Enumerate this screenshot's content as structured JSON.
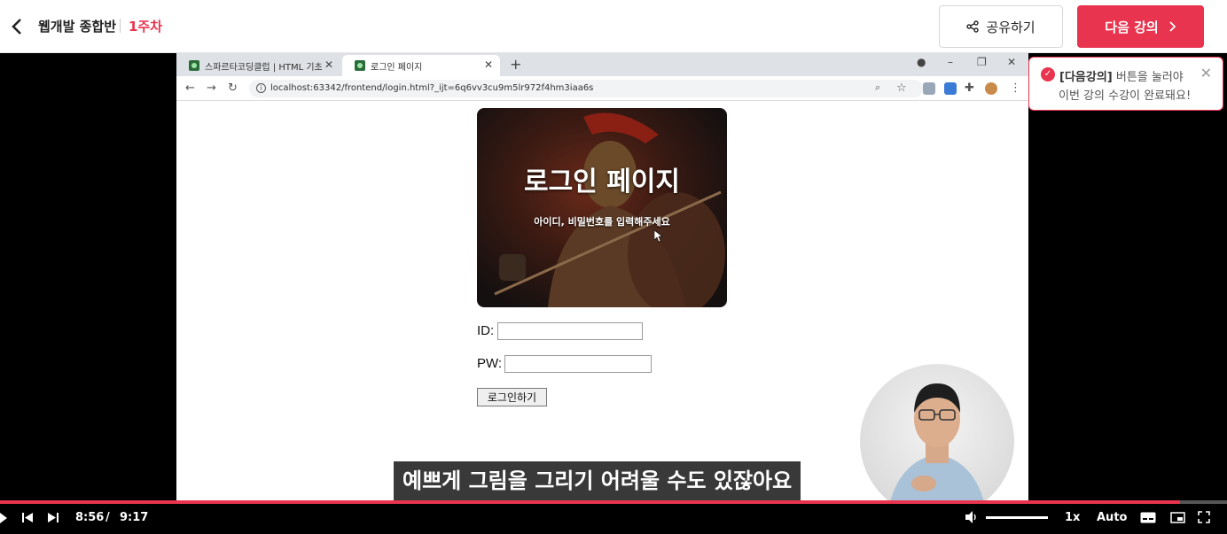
{
  "header": {
    "course_title": "웹개발 종합반",
    "week": "1주차",
    "share_label": "공유하기",
    "next_label": "다음 강의"
  },
  "tooltip": {
    "emphasis": "[다음강의]",
    "line1_rest": " 버튼을 눌러야",
    "line2": "이번 강의 수강이 완료돼요!"
  },
  "browser": {
    "tabs": [
      {
        "title": "스파르타코딩클럽 | HTML 기초",
        "active": false
      },
      {
        "title": "로그인 페이지",
        "active": true
      }
    ],
    "url": "localhost:63342/frontend/login.html?_ijt=6q6vv3cu9m5lr972f4hm3iaa6s",
    "page": {
      "hero_title": "로그인 페이지",
      "hero_subtitle": "아이디, 비밀번호를 입력해주세요",
      "id_label": "ID:",
      "pw_label": "PW:",
      "login_button": "로그인하기"
    }
  },
  "player": {
    "caption": "예쁘게 그림을 그리기 어려울 수도 있잖아요",
    "current_time": "8:56",
    "time_separator": "/",
    "duration": "9:17",
    "progress": 0.962,
    "speed": "1x",
    "quality": "Auto"
  },
  "colors": {
    "accent": "#e8344e",
    "player_bg": "#000000"
  },
  "icons": [
    "back-arrow-icon",
    "share-icon",
    "chevron-right-icon",
    "check-circle-icon",
    "close-icon",
    "play-icon",
    "skip-back-icon",
    "skip-forward-icon",
    "volume-icon",
    "subtitles-icon",
    "pip-icon",
    "fullscreen-icon"
  ]
}
